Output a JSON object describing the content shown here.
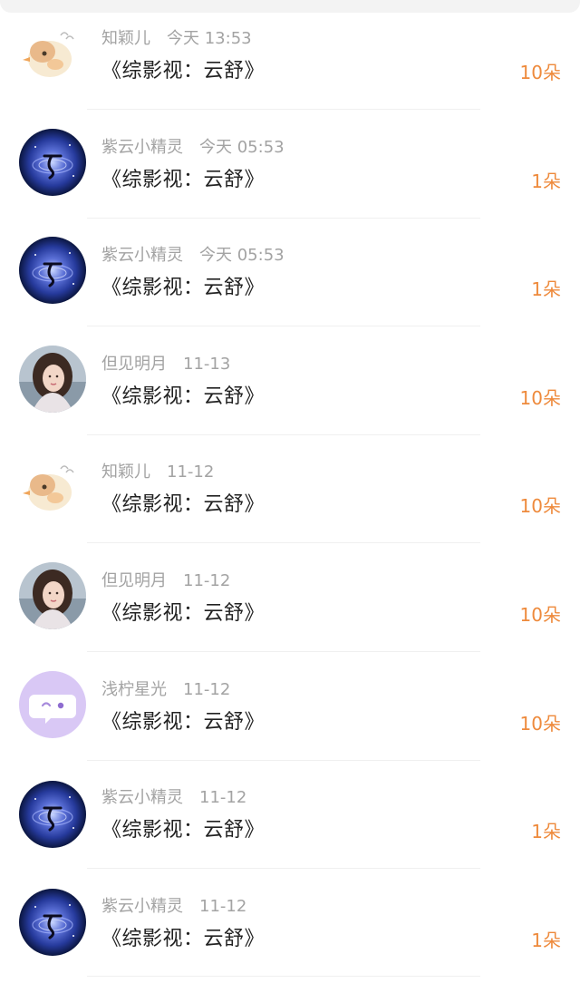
{
  "colors": {
    "amount": "#ee8a3c",
    "meta": "#a3a3a3",
    "title": "#222222"
  },
  "gifts": [
    {
      "user": "知颖儿",
      "time": "今天 13:53",
      "title": "《综影视：云舒》",
      "amount": "10朵",
      "avatar": "bird-avatar"
    },
    {
      "user": "紫云小精灵",
      "time": "今天 05:53",
      "title": "《综影视：云舒》",
      "amount": "1朵",
      "avatar": "galaxy-avatar"
    },
    {
      "user": "紫云小精灵",
      "time": "今天 05:53",
      "title": "《综影视：云舒》",
      "amount": "1朵",
      "avatar": "galaxy-avatar"
    },
    {
      "user": "但见明月",
      "time": "11-13",
      "title": "《综影视：云舒》",
      "amount": "10朵",
      "avatar": "portrait-avatar"
    },
    {
      "user": "知颖儿",
      "time": "11-12",
      "title": "《综影视：云舒》",
      "amount": "10朵",
      "avatar": "bird-avatar"
    },
    {
      "user": "但见明月",
      "time": "11-12",
      "title": "《综影视：云舒》",
      "amount": "10朵",
      "avatar": "portrait-avatar"
    },
    {
      "user": "浅柠星光",
      "time": "11-12",
      "title": "《综影视：云舒》",
      "amount": "10朵",
      "avatar": "chat-bubble-avatar"
    },
    {
      "user": "紫云小精灵",
      "time": "11-12",
      "title": "《综影视：云舒》",
      "amount": "1朵",
      "avatar": "galaxy-avatar"
    },
    {
      "user": "紫云小精灵",
      "time": "11-12",
      "title": "《综影视：云舒》",
      "amount": "1朵",
      "avatar": "galaxy-avatar"
    }
  ]
}
